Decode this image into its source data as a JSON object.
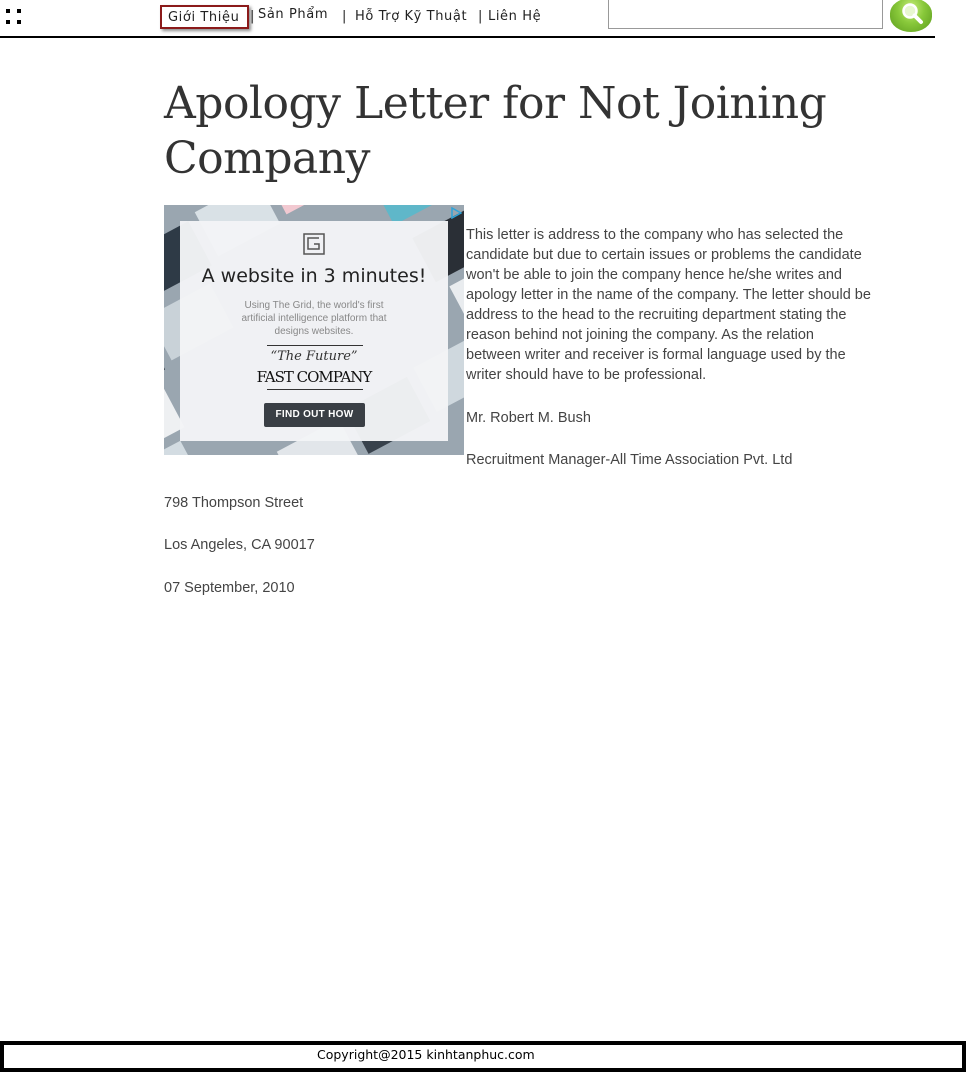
{
  "nav": {
    "items": [
      {
        "label": "Giới Thiệu"
      },
      {
        "label": "Sản Phẩm"
      },
      {
        "label": "Hỗ Trợ Kỹ Thuật"
      },
      {
        "label": "Liên Hệ"
      }
    ],
    "separator": "|"
  },
  "search": {
    "value": "",
    "icon": "magnifier-icon",
    "button_color": "#7fc23a"
  },
  "article": {
    "title": "Apology Letter for Not Joining Company",
    "intro": "This letter is address to the company who has selected the candidate but due to certain issues or problems the candidate won't be able to join the company hence he/she writes and apology letter in the name of the company. The letter should be address to the head to the recruiting department stating the reason behind not joining the company. As the relation between writer and receiver is formal language used by the writer should have to be professional.",
    "recipient": "Mr. Robert M. Bush",
    "role": "Recruitment Manager-All Time Association Pvt. Ltd",
    "street": "798 Thompson Street",
    "city": "Los Angeles, CA 90017",
    "date": "07 September, 2010"
  },
  "ad": {
    "headline": "A website in 3 minutes!",
    "subtext": "Using The Grid, the world's first artificial intelligence platform that designs websites.",
    "quote": "“The Future”",
    "brand": "FAST COMPANY",
    "cta": "FIND OUT HOW"
  },
  "footer": {
    "copyright": "Copyright@2015 kinhtanphuc.com"
  },
  "colors": {
    "active_nav_border": "#8b1a1a",
    "text": "#444444",
    "title": "#333333"
  }
}
